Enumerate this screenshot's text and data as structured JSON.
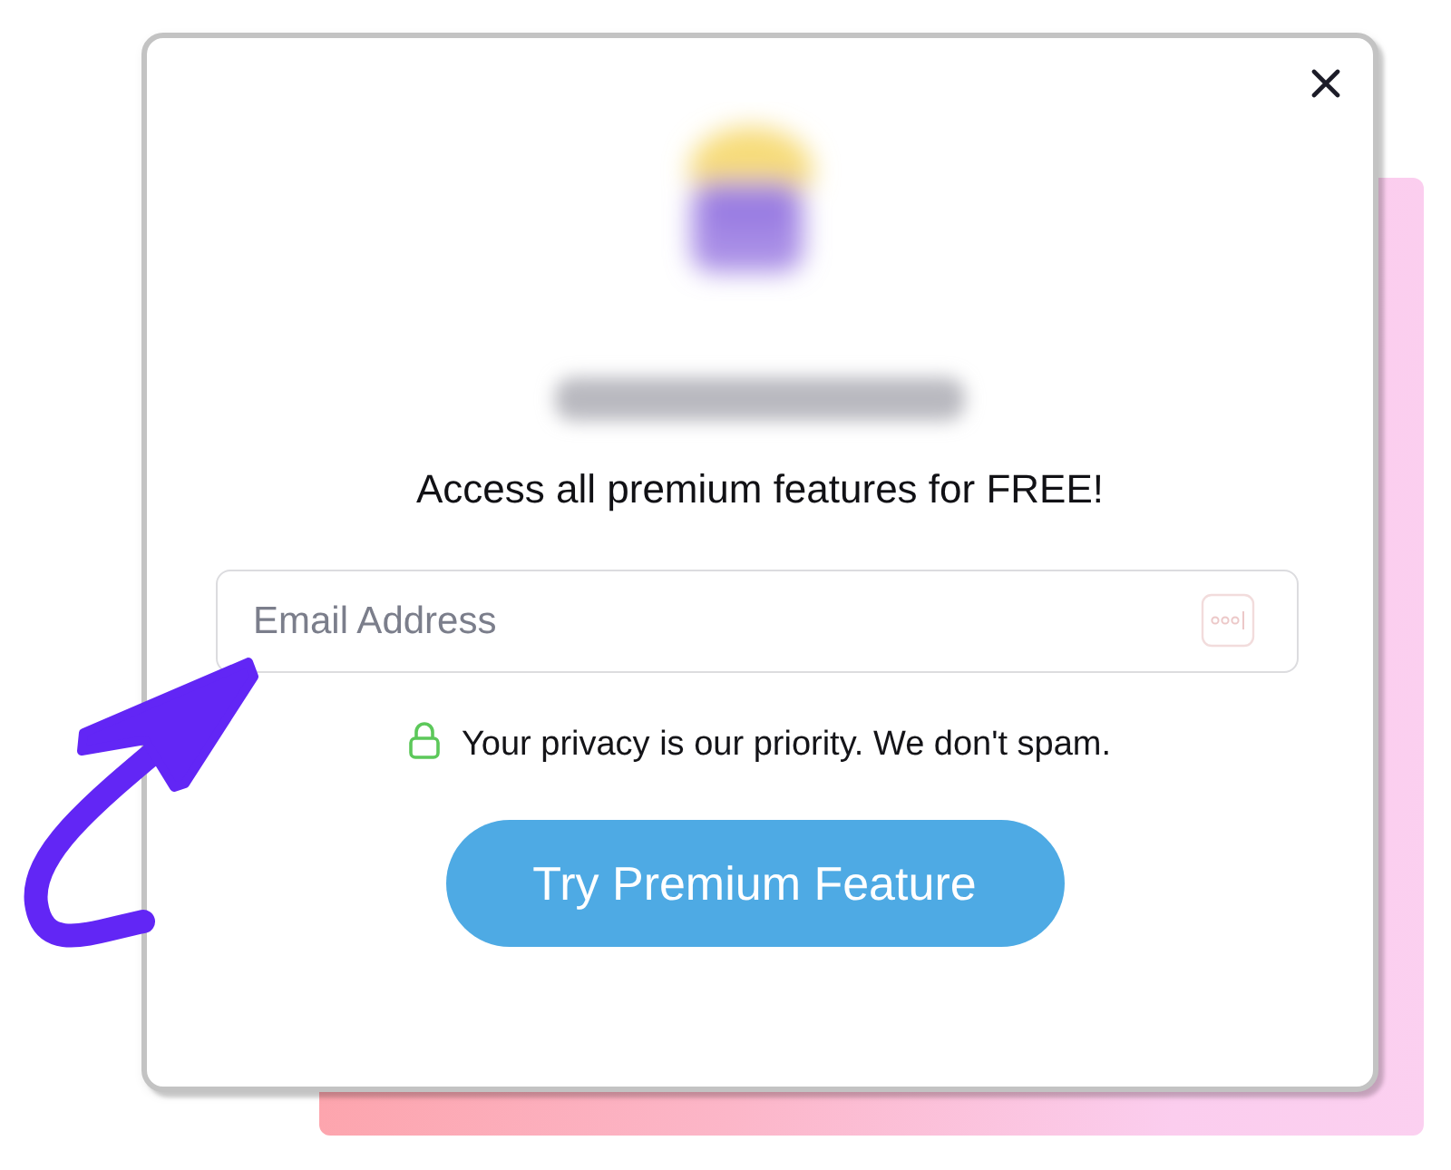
{
  "dialog": {
    "headline": "Access all premium features for FREE!",
    "email_field": {
      "placeholder": "Email Address"
    },
    "privacy_note": "Your privacy is our priority. We don't spam.",
    "submit_button": "Try Premium Feature"
  }
}
